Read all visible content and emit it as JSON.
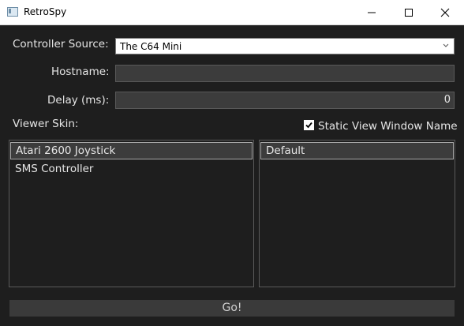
{
  "window": {
    "title": "RetroSpy"
  },
  "form": {
    "controller_source_label": "Controller Source:",
    "controller_source_value": "The C64 Mini",
    "hostname_label": "Hostname:",
    "hostname_value": "",
    "delay_label": "Delay (ms):",
    "delay_value": "0",
    "viewer_skin_label": "Viewer Skin:",
    "static_view_label": "Static View Window Name",
    "static_view_checked": true
  },
  "skins": {
    "items": [
      "Atari 2600 Joystick",
      "SMS Controller"
    ],
    "selected_index": 0
  },
  "backgrounds": {
    "items": [
      "Default"
    ],
    "selected_index": 0
  },
  "go_label": "Go!",
  "icons": {
    "app": "app-icon",
    "minimize": "minimize-icon",
    "maximize": "maximize-icon",
    "close": "close-icon",
    "dropdown": "chevron-down-icon",
    "check": "checkmark-icon"
  },
  "colors": {
    "window_bg": "#1e1e1e",
    "field_bg": "#3c3c3c",
    "selection_border": "#a8a8a8",
    "text": "#e6e6e6"
  }
}
